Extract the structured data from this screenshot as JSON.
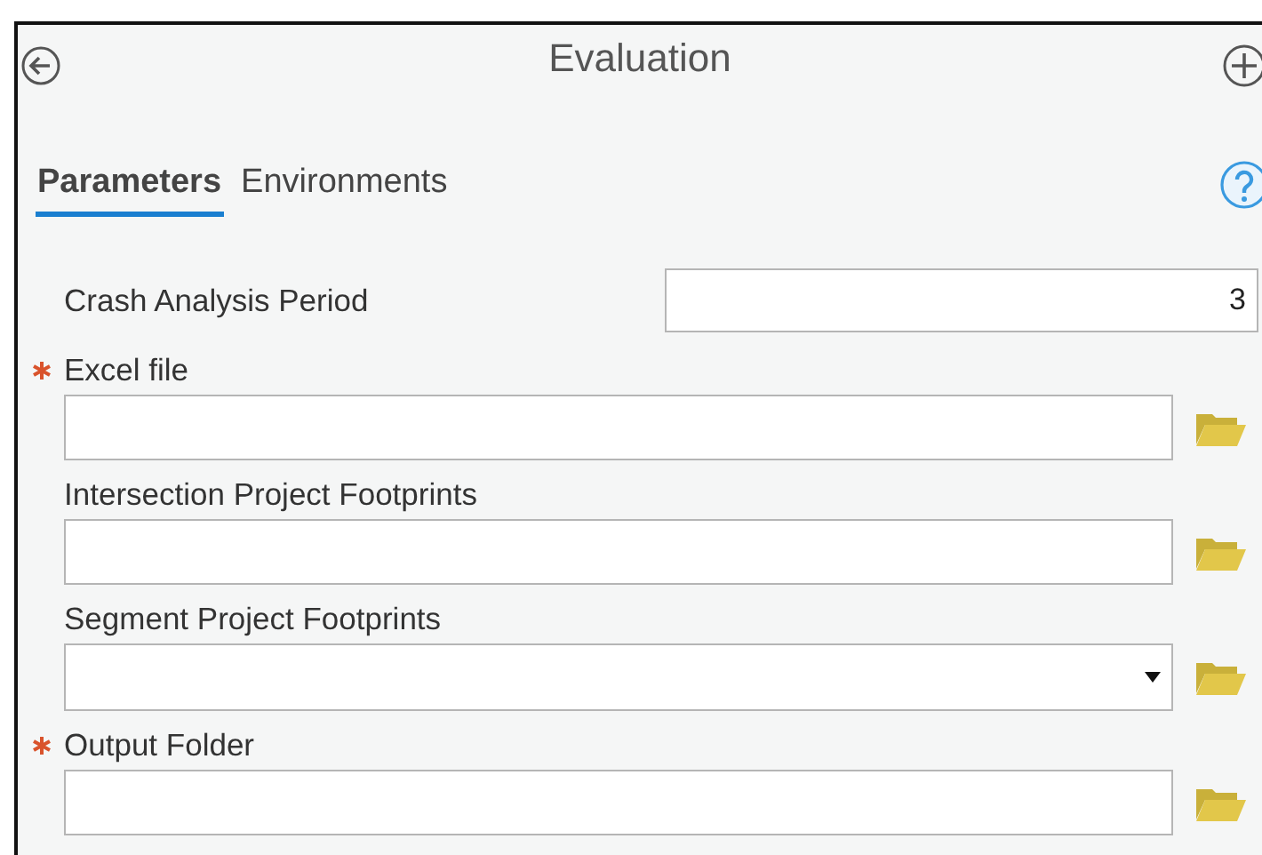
{
  "window": {
    "title": "Evaluation"
  },
  "tabs": [
    {
      "label": "Parameters",
      "selected": true
    },
    {
      "label": "Environments",
      "selected": false
    }
  ],
  "parameters": [
    {
      "kind": "number",
      "label": "Crash Analysis Period",
      "required": false,
      "value": "3"
    },
    {
      "kind": "file",
      "label": "Excel file",
      "required": true
    },
    {
      "kind": "file",
      "label": "Intersection Project Footprints",
      "required": false
    },
    {
      "kind": "dropdown",
      "label": "Segment Project Footprints",
      "required": false
    },
    {
      "kind": "file",
      "label": "Output Folder",
      "required": true
    }
  ]
}
